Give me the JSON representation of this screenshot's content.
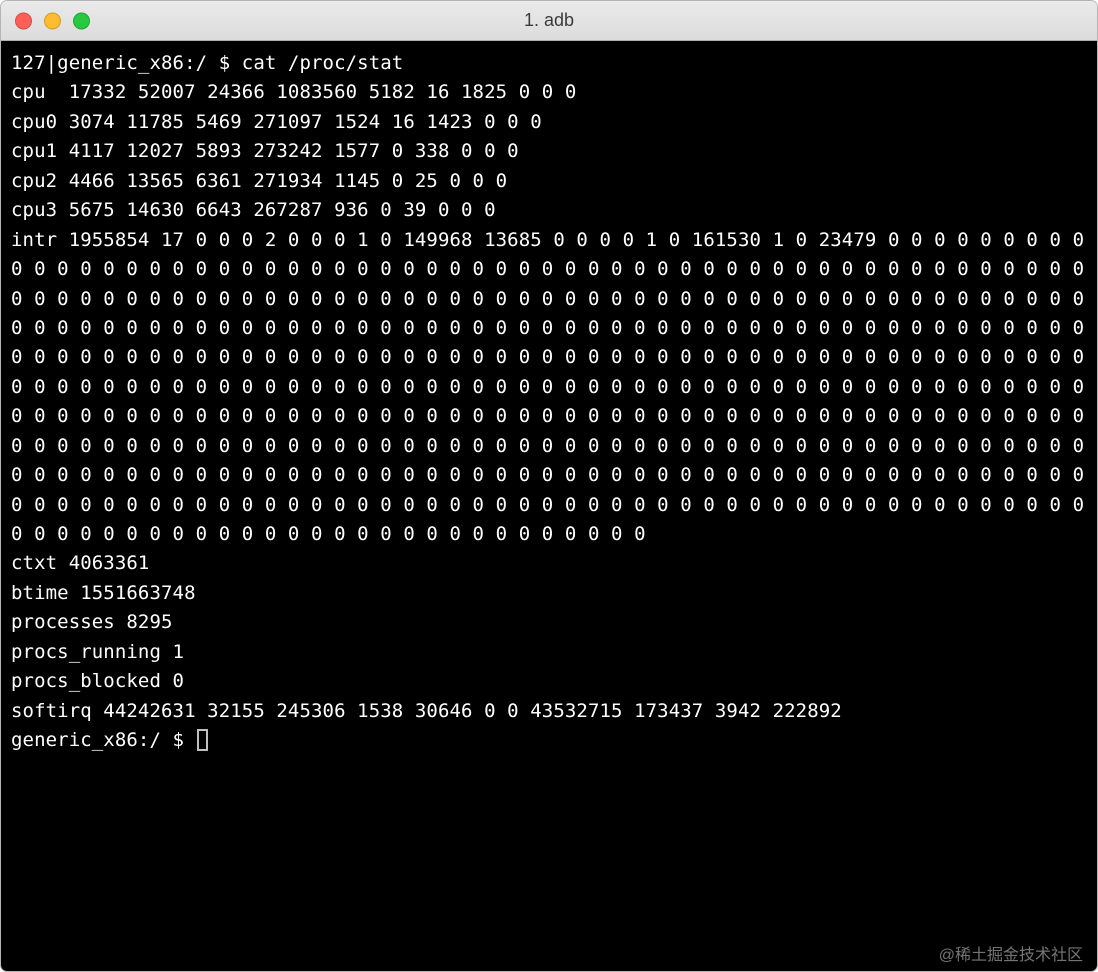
{
  "window": {
    "title": "1. adb"
  },
  "watermark": "@稀土掘金技术社区",
  "terminal": {
    "prompt1_prefix": "127|generic_x86:/ $ ",
    "prompt1_cmd": "cat /proc/stat",
    "prompt2_prefix": "generic_x86:/ $ ",
    "output": {
      "cpu": "cpu  17332 52007 24366 1083560 5182 16 1825 0 0 0",
      "cpu0": "cpu0 3074 11785 5469 271097 1524 16 1423 0 0 0",
      "cpu1": "cpu1 4117 12027 5893 273242 1577 0 338 0 0 0",
      "cpu2": "cpu2 4466 13565 6361 271934 1145 0 25 0 0 0",
      "cpu3": "cpu3 5675 14630 6643 267287 936 0 39 0 0 0",
      "intr": "intr 1955854 17 0 0 0 2 0 0 0 1 0 149968 13685 0 0 0 0 1 0 161530 1 0 23479 0 0 0 0 0 0 0 0 0 0 0 0 0 0 0 0 0 0 0 0 0 0 0 0 0 0 0 0 0 0 0 0 0 0 0 0 0 0 0 0 0 0 0 0 0 0 0 0 0 0 0 0 0 0 0 0 0 0 0 0 0 0 0 0 0 0 0 0 0 0 0 0 0 0 0 0 0 0 0 0 0 0 0 0 0 0 0 0 0 0 0 0 0 0 0 0 0 0 0 0 0 0 0 0 0 0 0 0 0 0 0 0 0 0 0 0 0 0 0 0 0 0 0 0 0 0 0 0 0 0 0 0 0 0 0 0 0 0 0 0 0 0 0 0 0 0 0 0 0 0 0 0 0 0 0 0 0 0 0 0 0 0 0 0 0 0 0 0 0 0 0 0 0 0 0 0 0 0 0 0 0 0 0 0 0 0 0 0 0 0 0 0 0 0 0 0 0 0 0 0 0 0 0 0 0 0 0 0 0 0 0 0 0 0 0 0 0 0 0 0 0 0 0 0 0 0 0 0 0 0 0 0 0 0 0 0 0 0 0 0 0 0 0 0 0 0 0 0 0 0 0 0 0 0 0 0 0 0 0 0 0 0 0 0 0 0 0 0 0 0 0 0 0 0 0 0 0 0 0 0 0 0 0 0 0 0 0 0 0 0 0 0 0 0 0 0 0 0 0 0 0 0 0 0 0 0 0 0 0 0 0 0 0 0 0 0 0 0 0 0 0 0 0 0 0 0 0 0 0 0 0 0 0 0 0 0 0 0 0 0 0 0 0 0 0 0 0 0 0 0 0 0 0 0 0 0 0 0 0 0 0 0 0 0 0 0 0 0 0 0 0 0 0 0 0 0 0 0 0 0 0 0 0 0 0 0 0 0 0 0 0 0 0 0 0 0 0 0 0 0 0 0 0 0 0 0 0 0 0 0 0 0 0 0 0 0 0 0 0 0 0 0 0 0 0 0 0 0 0 0 0 0 0 0 0 0 0 0 0 0 0 0 0 0 0 0 0 0 0 0 0 0 0 0 0 0 0 0 0 0",
      "ctxt": "ctxt 4063361",
      "btime": "btime 1551663748",
      "processes": "processes 8295",
      "procs_running": "procs_running 1",
      "procs_blocked": "procs_blocked 0",
      "softirq": "softirq 44242631 32155 245306 1538 30646 0 0 43532715 173437 3942 222892"
    }
  }
}
